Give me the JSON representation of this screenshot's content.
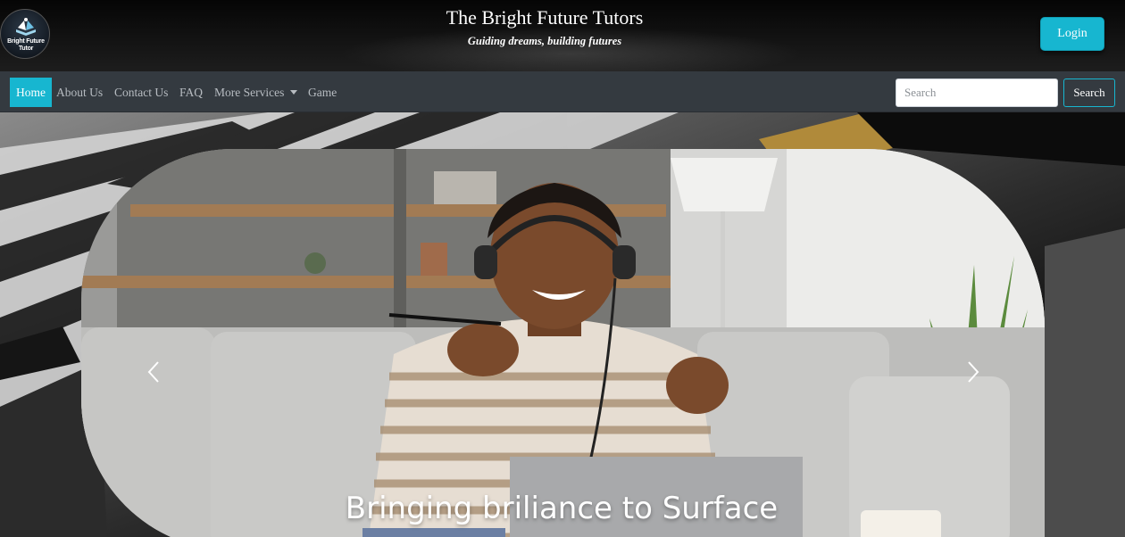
{
  "header": {
    "logo_text": "Bright Future Tutor",
    "title": "The Bright Future Tutors",
    "tagline": "Guiding dreams, building futures",
    "login_label": "Login"
  },
  "nav": {
    "items": [
      {
        "label": "Home",
        "active": true
      },
      {
        "label": "About Us"
      },
      {
        "label": "Contact Us"
      },
      {
        "label": "FAQ"
      },
      {
        "label": "More Services",
        "dropdown": true
      },
      {
        "label": "Game"
      }
    ],
    "search_placeholder": "Search",
    "search_button": "Search"
  },
  "hero": {
    "caption": "Bringing briliance to Surface"
  },
  "colors": {
    "accent": "#17b6d0",
    "navbar": "#343a40",
    "header": "#0d0d0d"
  }
}
